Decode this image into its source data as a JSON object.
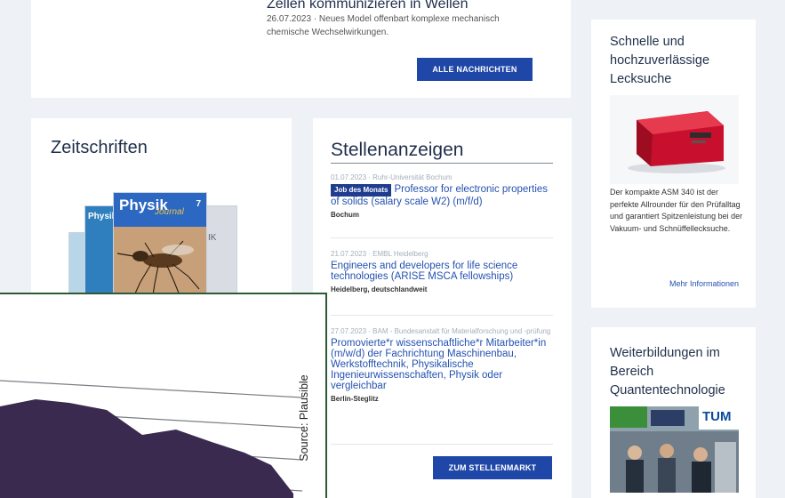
{
  "news": {
    "title": "Zellen kommunizieren in Wellen",
    "meta": "26.07.2023 · Neues Model offenbart komplexe mechanisch chemische Wechselwirkungen.",
    "button": "ALLE NACHRICHTEN"
  },
  "journals": {
    "heading": "Zeitschriften",
    "cover_title": "Physik",
    "cover_subtitle": "Journal",
    "cover_issue": "7",
    "cover_back": "Physik",
    "cover_side": "IK"
  },
  "jobs": {
    "heading": "Stellenanzeigen",
    "items": [
      {
        "meta": "01.07.2023 · Ruhr-Universität Bochum",
        "badge": "Job des Monats",
        "title": "Professor for electronic properties of solids (salary scale W2) (m/f/d)",
        "location": "Bochum"
      },
      {
        "meta": "21.07.2023 · EMBL Heidelberg",
        "badge": "",
        "title": "Engineers and developers for life science technologies (ARISE MSCA fellowships)",
        "location": "Heidelberg, deutschlandweit"
      },
      {
        "meta": "27.07.2023 · BAM - Bundesanstalt für Materialforschung und -prüfung",
        "badge": "",
        "title": "Promovierte*r wissenschaftliche*r Mitarbeiter*in (m/w/d) der Fachrichtung Maschinenbau, Werkstofftechnik, Physikalische Ingenieurwissenschaften, Physik oder vergleichbar",
        "location": "Berlin-Steglitz"
      }
    ],
    "button": "ZUM STELLENMARKT"
  },
  "ad": {
    "heading": "Schnelle und hochzuverlässige Lecksuche",
    "text": "Der kompakte ASM 340 ist der perfekte Allrounder für den Prüfalltag und garantiert Spitzenleistung bei der Vakuum- und Schnüffellecksuche.",
    "link": "Mehr Informationen"
  },
  "qt": {
    "heading": "Weiterbildungen im Bereich Quantentechnologie",
    "logo": "TUM"
  },
  "overlay": {
    "source": "Source: Plausible"
  },
  "colors": {
    "accent": "#1f47a8",
    "link": "#2452b0",
    "overlay_fill": "#3b2a4f",
    "overlay_border": "#2b5b36"
  }
}
